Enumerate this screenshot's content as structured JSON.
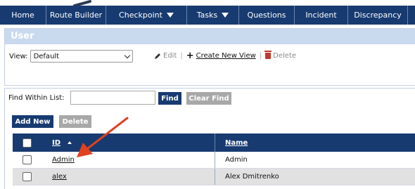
{
  "nav": {
    "items": [
      {
        "label": "Home",
        "dropdown": false
      },
      {
        "label": "Route Builder",
        "dropdown": false
      },
      {
        "label": "Checkpoint",
        "dropdown": true
      },
      {
        "label": "Tasks",
        "dropdown": true
      },
      {
        "label": "Questions",
        "dropdown": false
      },
      {
        "label": "Incident",
        "dropdown": false
      },
      {
        "label": "Discrepancy",
        "dropdown": false
      }
    ]
  },
  "panel": {
    "title": "User",
    "view_label": "View:",
    "view_selected": "Default",
    "edit_label": "Edit",
    "create_label": "Create New View",
    "delete_label": "Delete"
  },
  "find": {
    "label": "Find Within List:",
    "value": "",
    "find_button": "Find",
    "clear_button": "Clear Find"
  },
  "list_actions": {
    "add_new": "Add New",
    "delete": "Delete"
  },
  "table": {
    "columns": [
      "ID",
      "Name"
    ],
    "rows": [
      {
        "id": "Admin",
        "name": "Admin"
      },
      {
        "id": "alex",
        "name": "Alex Dmitrenko"
      }
    ]
  },
  "colors": {
    "nav_bg": "#173a70",
    "panel_header": "#c9d9ee",
    "disabled_button": "#a8a8a8",
    "annotation_arrow": "#e0411f"
  }
}
